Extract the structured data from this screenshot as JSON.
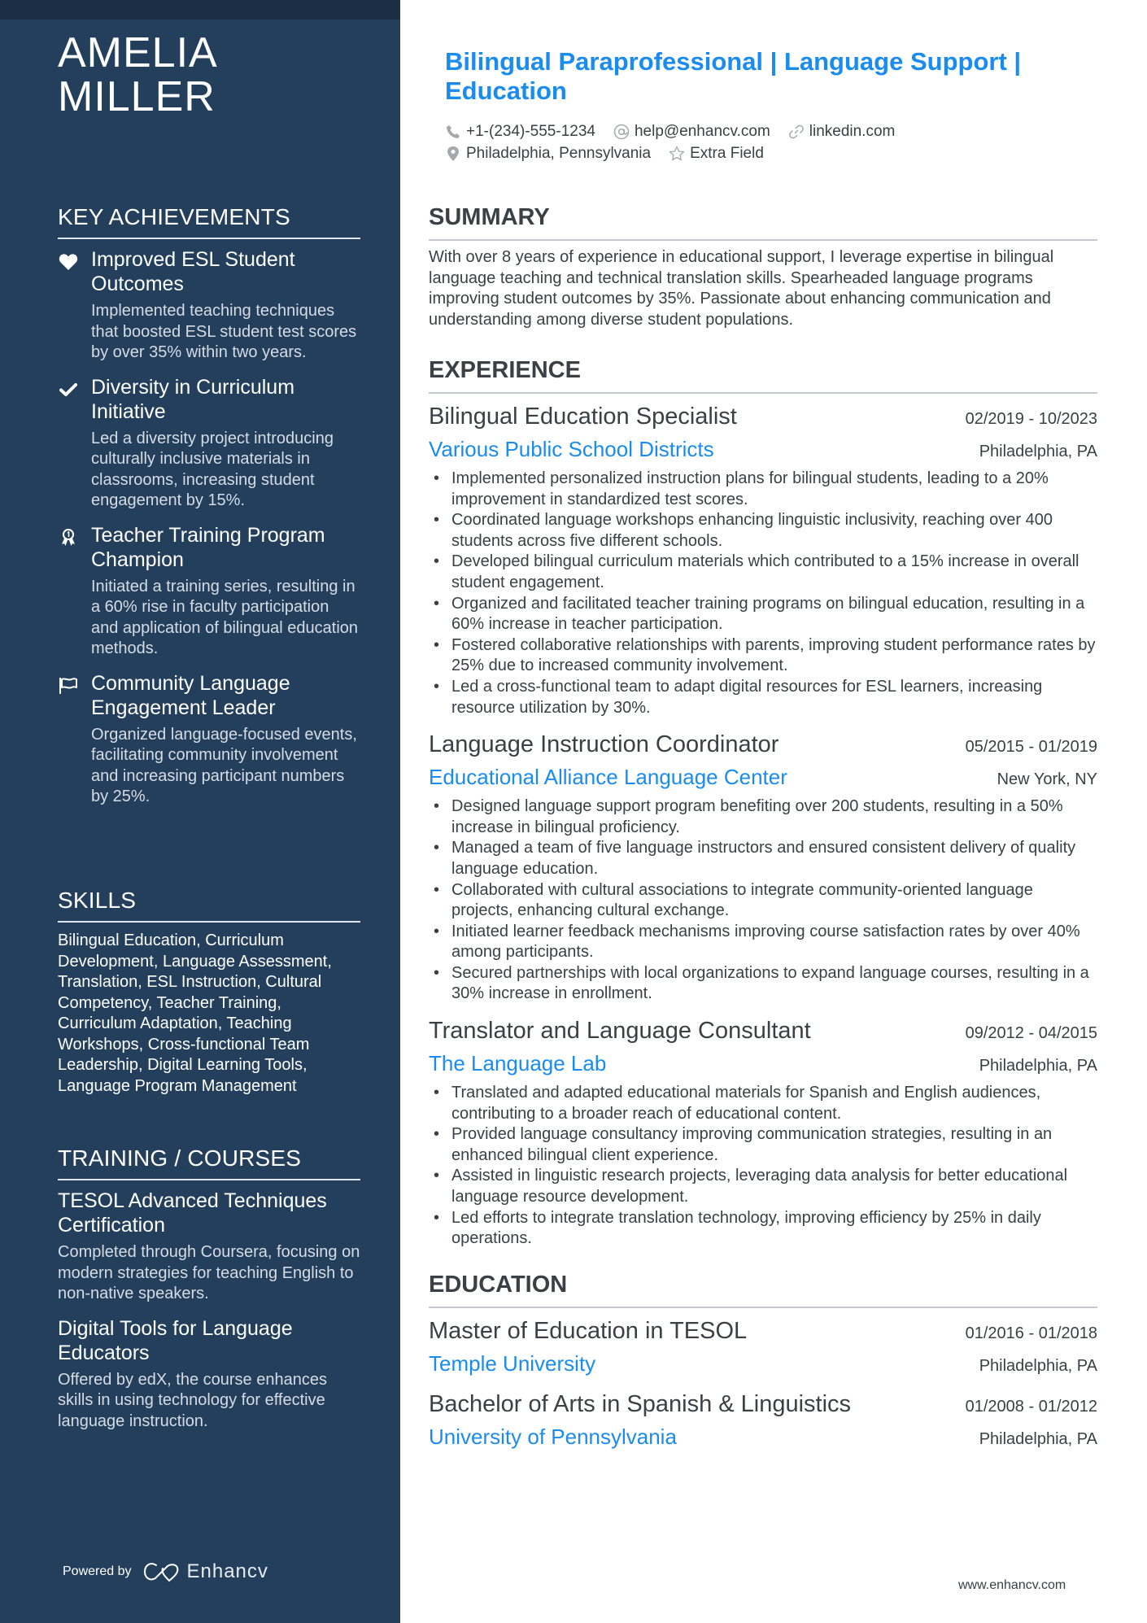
{
  "profile": {
    "first_name": "AMELIA",
    "last_name": "MILLER",
    "title": "Bilingual Paraprofessional | Language Support | Education",
    "contacts": {
      "phone": "+1-(234)-555-1234",
      "email": "help@enhancv.com",
      "linkedin": "linkedin.com",
      "location": "Philadelphia, Pennsylvania",
      "extra": "Extra Field"
    }
  },
  "sidebar": {
    "achievements": {
      "heading": "KEY ACHIEVEMENTS",
      "items": [
        {
          "icon": "heart-icon",
          "title": "Improved ESL Student Outcomes",
          "desc": "Implemented teaching techniques that boosted ESL student test scores by over 35% within two years."
        },
        {
          "icon": "check-icon",
          "title": "Diversity in Curriculum Initiative",
          "desc": "Led a diversity project introducing culturally inclusive materials in classrooms, increasing student engagement by 15%."
        },
        {
          "icon": "award-icon",
          "title": "Teacher Training Program Champion",
          "desc": "Initiated a training series, resulting in a 60% rise in faculty participation and application of bilingual education methods."
        },
        {
          "icon": "flag-icon",
          "title": "Community Language Engagement Leader",
          "desc": "Organized language-focused events, facilitating community involvement and increasing participant numbers by 25%."
        }
      ]
    },
    "skills": {
      "heading": "SKILLS",
      "text": "Bilingual Education, Curriculum Development, Language Assessment, Translation, ESL Instruction, Cultural Competency, Teacher Training, Curriculum Adaptation, Teaching Workshops, Cross-functional Team Leadership, Digital Learning Tools, Language Program Management"
    },
    "training": {
      "heading": "TRAINING / COURSES",
      "items": [
        {
          "title": "TESOL Advanced Techniques Certification",
          "desc": "Completed through Coursera, focusing on modern strategies for teaching English to non-native speakers."
        },
        {
          "title": "Digital Tools for Language Educators",
          "desc": "Offered by edX, the course enhances skills in using technology for effective language instruction."
        }
      ]
    },
    "footer": {
      "powered_by": "Powered by",
      "brand": "Enhancv"
    }
  },
  "main": {
    "summary": {
      "heading": "SUMMARY",
      "text": "With over 8 years of experience in educational support, I leverage expertise in bilingual language teaching and technical translation skills. Spearheaded language programs improving student outcomes by 35%. Passionate about enhancing communication and understanding among diverse student populations."
    },
    "experience": {
      "heading": "EXPERIENCE",
      "jobs": [
        {
          "title": "Bilingual Education Specialist",
          "dates": "02/2019 - 10/2023",
          "company": "Various Public School Districts",
          "location": "Philadelphia, PA",
          "bullets": [
            "Implemented personalized instruction plans for bilingual students, leading to a 20% improvement in standardized test scores.",
            "Coordinated language workshops enhancing linguistic inclusivity, reaching over 400 students across five different schools.",
            "Developed bilingual curriculum materials which contributed to a 15% increase in overall student engagement.",
            "Organized and facilitated teacher training programs on bilingual education, resulting in a 60% increase in teacher participation.",
            "Fostered collaborative relationships with parents, improving student performance rates by 25% due to increased community involvement.",
            "Led a cross-functional team to adapt digital resources for ESL learners, increasing resource utilization by 30%."
          ]
        },
        {
          "title": "Language Instruction Coordinator",
          "dates": "05/2015 - 01/2019",
          "company": "Educational Alliance Language Center",
          "location": "New York, NY",
          "bullets": [
            "Designed language support program benefiting over 200 students, resulting in a 50% increase in bilingual proficiency.",
            "Managed a team of five language instructors and ensured consistent delivery of quality language education.",
            "Collaborated with cultural associations to integrate community-oriented language projects, enhancing cultural exchange.",
            "Initiated learner feedback mechanisms improving course satisfaction rates by over 40% among participants.",
            "Secured partnerships with local organizations to expand language courses, resulting in a 30% increase in enrollment."
          ]
        },
        {
          "title": "Translator and Language Consultant",
          "dates": "09/2012 - 04/2015",
          "company": "The Language Lab",
          "location": "Philadelphia, PA",
          "bullets": [
            "Translated and adapted educational materials for Spanish and English audiences, contributing to a broader reach of educational content.",
            "Provided language consultancy improving communication strategies, resulting in an enhanced bilingual client experience.",
            "Assisted in linguistic research projects, leveraging data analysis for better educational language resource development.",
            "Led efforts to integrate translation technology, improving efficiency by 25% in daily operations."
          ]
        }
      ]
    },
    "education": {
      "heading": "EDUCATION",
      "items": [
        {
          "degree": "Master of Education in TESOL",
          "dates": "01/2016 - 01/2018",
          "school": "Temple University",
          "location": "Philadelphia, PA"
        },
        {
          "degree": "Bachelor of Arts in Spanish & Linguistics",
          "dates": "01/2008 - 01/2012",
          "school": "University of Pennsylvania",
          "location": "Philadelphia, PA"
        }
      ]
    },
    "website": "www.enhancv.com"
  },
  "colors": {
    "sidebar_bg": "#243f5c",
    "topbar_bg": "#1c2e44",
    "accent": "#1a8cf0",
    "text": "#3b4045"
  }
}
